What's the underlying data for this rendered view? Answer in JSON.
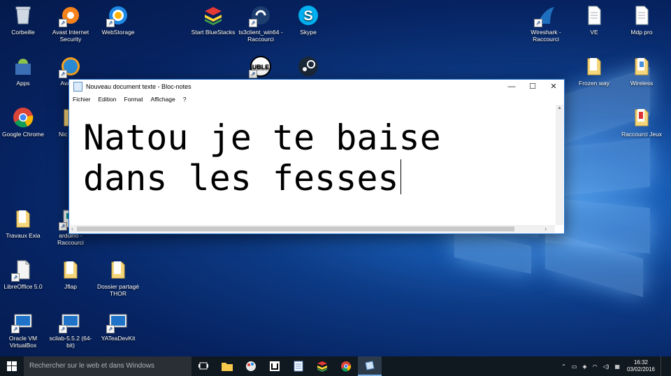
{
  "desktop": {
    "icons": [
      {
        "id": "corbeille",
        "label": "Corbeille",
        "icon": "recycle-bin-icon"
      },
      {
        "id": "avast",
        "label": "Avast Internet Security",
        "icon": "avast-icon"
      },
      {
        "id": "webstorage",
        "label": "WebStorage",
        "icon": "webstorage-icon"
      },
      {
        "id": "bluestacks",
        "label": "Start BlueStacks",
        "icon": "bluestacks-icon"
      },
      {
        "id": "ts3",
        "label": "ts3client_win64 - Raccourci",
        "icon": "teamspeak-icon"
      },
      {
        "id": "skype",
        "label": "Skype",
        "icon": "skype-icon"
      },
      {
        "id": "wireshark",
        "label": "Wireshark - Raccourci",
        "icon": "wireshark-icon"
      },
      {
        "id": "ve",
        "label": "VE",
        "icon": "text-file-icon"
      },
      {
        "id": "mdp",
        "label": "Mdp pro",
        "icon": "text-file-icon"
      },
      {
        "id": "apps",
        "label": "Apps",
        "icon": "android-icon"
      },
      {
        "id": "avast2",
        "label": "Avast S",
        "icon": "globe-icon"
      },
      {
        "id": "uble",
        "label": "",
        "icon": "uble-icon"
      },
      {
        "id": "steam",
        "label": "",
        "icon": "steam-icon"
      },
      {
        "id": "frozen",
        "label": "Frozen way",
        "icon": "folder-icon"
      },
      {
        "id": "wireless",
        "label": "Wireless",
        "icon": "folder-icon"
      },
      {
        "id": "chrome",
        "label": "Google Chrome",
        "icon": "chrome-icon"
      },
      {
        "id": "nic",
        "label": "Nic Racc",
        "icon": "folder-icon"
      },
      {
        "id": "raccjeux",
        "label": "Raccourci Jeux",
        "icon": "folder-icon"
      },
      {
        "id": "exia",
        "label": "Travaux Exia",
        "icon": "folder-icon"
      },
      {
        "id": "arduino",
        "label": "arduino - Raccourci",
        "icon": "arduino-icon"
      },
      {
        "id": "libre",
        "label": "LibreOffice 5.0",
        "icon": "libreoffice-icon"
      },
      {
        "id": "jflap",
        "label": "Jflap",
        "icon": "folder-icon"
      },
      {
        "id": "thor",
        "label": "Dossier partagé THOR",
        "icon": "folder-icon"
      },
      {
        "id": "vbox",
        "label": "Oracle VM VirtualBox",
        "icon": "app-window-icon"
      },
      {
        "id": "scilab",
        "label": "scilab-5.5.2 (64-bit)",
        "icon": "app-window-icon"
      },
      {
        "id": "yatea",
        "label": "YATeaDevKit",
        "icon": "app-window-icon"
      }
    ]
  },
  "notepad": {
    "title": "Nouveau document texte - Bloc-notes",
    "menu": [
      "Fichier",
      "Edition",
      "Format",
      "Affichage",
      "?"
    ],
    "content": "Natou je te baise\ndans les fesses",
    "buttons": {
      "minimize": "—",
      "maximize": "☐",
      "close": "✕"
    }
  },
  "taskbar": {
    "search_placeholder": "Rechercher sur le web et dans Windows",
    "items": [
      "task-view",
      "file-explorer",
      "paint",
      "uble",
      "notepad",
      "bluestacks",
      "chrome",
      "notepad-active"
    ],
    "time": "16:32",
    "date": "03/02/2016"
  },
  "colors": {
    "accent": "#2b78d4",
    "taskbar": "#101820",
    "desktop": "#0d3b86"
  }
}
